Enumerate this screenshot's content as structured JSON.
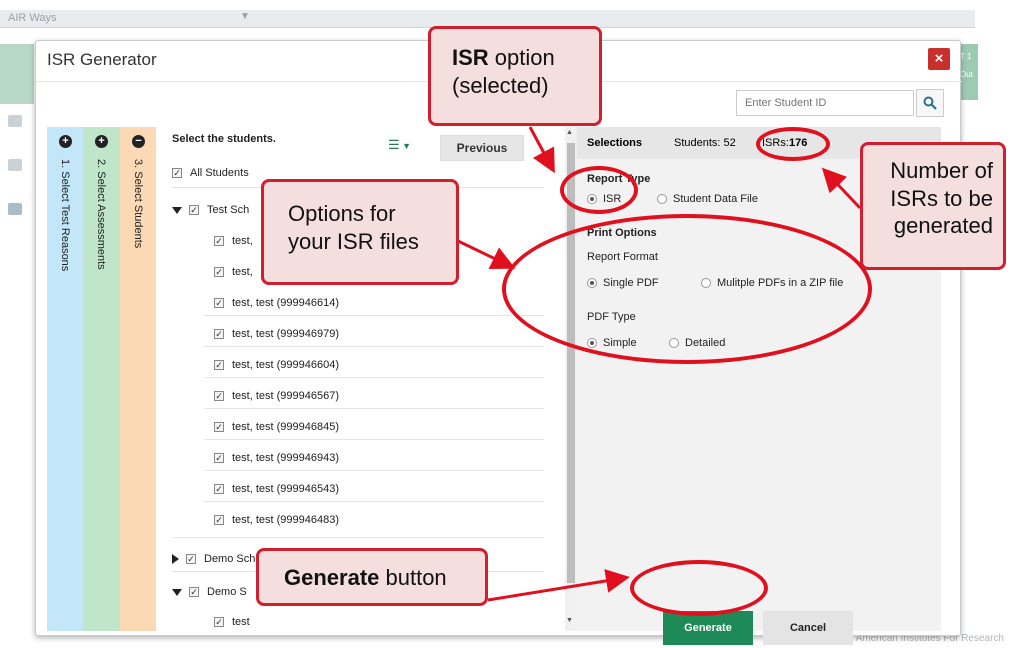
{
  "background": {
    "app_name": "AIR Ways",
    "right_strip_text": "T 1\nOut",
    "copyright": "© 2019 American Institutes For Research"
  },
  "modal": {
    "title": "ISR Generator",
    "close_label": "×",
    "search_placeholder": "Enter Student ID",
    "search_icon": "search-icon"
  },
  "steps": [
    {
      "icon": "+",
      "label": "1. Select Test Reasons",
      "color": "#c3e7f9"
    },
    {
      "icon": "+",
      "label": "2. Select Assessments",
      "color": "#bfe6c8"
    },
    {
      "icon": "−",
      "label": "3. Select Students",
      "color": "#fbd9b5"
    }
  ],
  "students": {
    "heading": "Select the students.",
    "filter_icon": "filter-icon",
    "previous_label": "Previous",
    "all_students": "All Students",
    "school1": "Test Sch",
    "students_partial": [
      "test,",
      "test,"
    ],
    "list": [
      "test, test (999946614)",
      "test, test (999946979)",
      "test, test (999946604)",
      "test, test (999946567)",
      "test, test (999946845)",
      "test, test (999946943)",
      "test, test (999946543)",
      "test, test (999946483)"
    ],
    "school2": "Demo School VT 1",
    "school3": "Demo S",
    "last_partial": "test"
  },
  "selections": {
    "title": "Selections",
    "students_count": "Students: 52",
    "isrs_label": "ISRs:",
    "isrs_count": "176",
    "report_type_label": "Report Type",
    "isr_option": "ISR",
    "student_data_option": "Student Data File",
    "print_options_label": "Print Options",
    "report_format_label": "Report Format",
    "single_pdf": "Single PDF",
    "multiple_pdfs": "Mulitple PDFs in a ZIP file",
    "pdf_type_label": "PDF Type",
    "simple": "Simple",
    "detailed": "Detailed",
    "generate_label": "Generate",
    "cancel_label": "Cancel"
  },
  "callouts": {
    "isr_option_bold": "ISR",
    "isr_option_rest": " option",
    "isr_option_line2": "(selected)",
    "options_line1": "Options for",
    "options_line2": "your ISR files",
    "number_line1": "Number of",
    "number_line2": "ISRs to be",
    "number_line3": "generated",
    "generate_bold": "Generate",
    "generate_rest": " button",
    "color_red": "#d01f2e",
    "color_fill": "#f4dede"
  }
}
